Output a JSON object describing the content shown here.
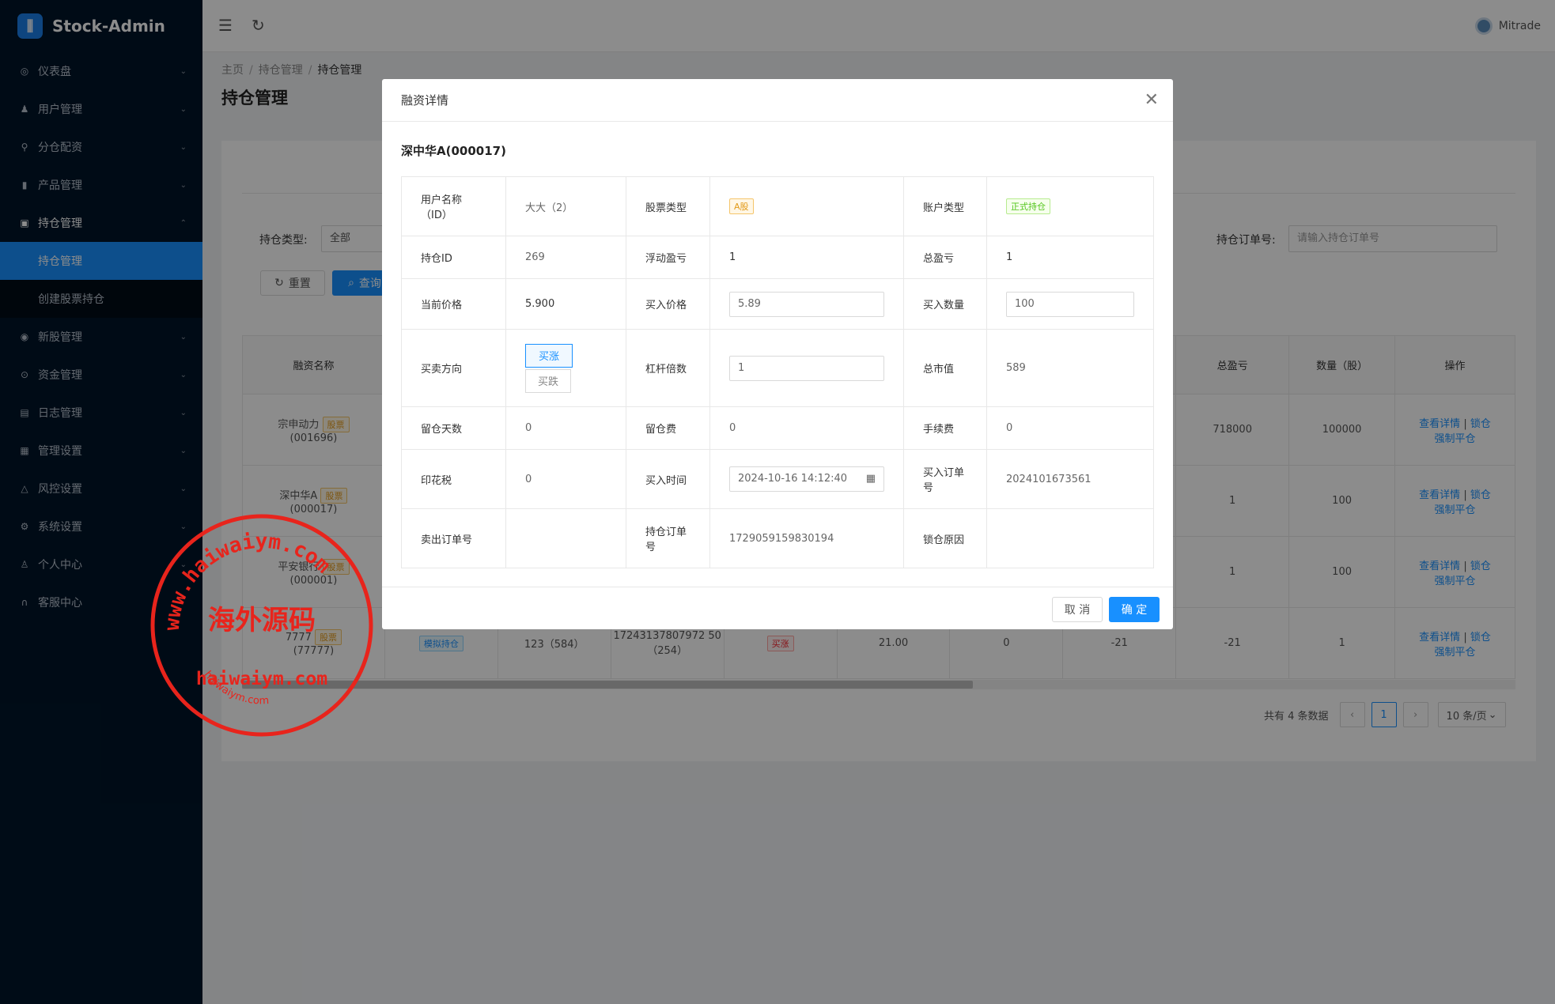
{
  "app": {
    "name": "Stock-Admin",
    "user": "Mitrade"
  },
  "sidebar": {
    "items": [
      {
        "label": "仪表盘",
        "icon": "dashboard-icon"
      },
      {
        "label": "用户管理",
        "icon": "users-icon"
      },
      {
        "label": "分仓配资",
        "icon": "tree-icon"
      },
      {
        "label": "产品管理",
        "icon": "chart-icon"
      },
      {
        "label": "持仓管理",
        "icon": "position-icon"
      }
    ],
    "sub": [
      "持仓管理",
      "创建股票持仓"
    ],
    "items2": [
      {
        "label": "新股管理",
        "icon": "ipo-icon"
      },
      {
        "label": "资金管理",
        "icon": "money-icon"
      },
      {
        "label": "日志管理",
        "icon": "log-icon"
      },
      {
        "label": "管理设置",
        "icon": "admin-icon"
      },
      {
        "label": "风控设置",
        "icon": "warning-icon"
      },
      {
        "label": "系统设置",
        "icon": "settings-icon"
      },
      {
        "label": "个人中心",
        "icon": "person-icon"
      },
      {
        "label": "客服中心",
        "icon": "headset-icon"
      }
    ]
  },
  "breadcrumb": [
    "主页",
    "持仓管理",
    "持仓管理"
  ],
  "page_title": "持仓管理",
  "filters": {
    "type_label": "持仓类型:",
    "type_value": "全部",
    "order_label": "持仓订单号:",
    "order_placeholder": "请输入持仓订单号",
    "reset": "重置",
    "query": "查询"
  },
  "table": {
    "headers": [
      "融资名称",
      "总盈亏",
      "数量（股）",
      "操作"
    ],
    "rows": [
      {
        "name": "宗申动力",
        "tag": "股票",
        "code": "(001696)",
        "pnl": "718000",
        "qty": "100000"
      },
      {
        "name": "深中华A",
        "tag": "股票",
        "code": "(000017)",
        "pnl": "1",
        "qty": "100"
      },
      {
        "name": "平安银行",
        "tag": "股票",
        "code": "(000001)",
        "pnl": "1",
        "qty": "100"
      },
      {
        "name": "7777",
        "tag": "股票",
        "code": "(77777)",
        "acct": "模拟持仓",
        "user": "123（584）",
        "order": "17243137807972 50（254）",
        "dir": "买涨",
        "price": "21.00",
        "f1": "0",
        "f2": "-21",
        "pnl": "-21",
        "qty": "1"
      }
    ],
    "actions": {
      "detail": "查看详情",
      "lock": "锁仓",
      "force": "强制平仓"
    }
  },
  "pagination": {
    "total": "共有 4 条数据",
    "page": "1",
    "size": "10 条/页"
  },
  "modal": {
    "title": "融资详情",
    "stock": "深中华A(000017)",
    "labels": {
      "user": "用户名称（ID）",
      "stock_type": "股票类型",
      "acct_type": "账户类型",
      "pos_id": "持仓ID",
      "float_pnl": "浮动盈亏",
      "total_pnl": "总盈亏",
      "cur_price": "当前价格",
      "buy_price": "买入价格",
      "buy_qty": "买入数量",
      "direction": "买卖方向",
      "leverage": "杠杆倍数",
      "market_value": "总市值",
      "hold_days": "留仓天数",
      "hold_fee": "留仓费",
      "fee": "手续费",
      "stamp": "印花税",
      "buy_time": "买入时间",
      "buy_order": "买入订单号",
      "sell_order": "卖出订单号",
      "pos_order": "持仓订单号",
      "lock_reason": "锁仓原因"
    },
    "values": {
      "user": "大大（2）",
      "stock_type": "A股",
      "acct_type": "正式持仓",
      "pos_id": "269",
      "float_pnl": "1",
      "total_pnl": "1",
      "cur_price": "5.900",
      "buy_price": "5.89",
      "buy_qty": "100",
      "dir_up": "买涨",
      "dir_down": "买跌",
      "leverage": "1",
      "market_value": "589",
      "hold_days": "0",
      "hold_fee": "0",
      "fee": "0",
      "stamp": "0",
      "buy_time": "2024-10-16 14:12:40",
      "buy_order": "2024101673561",
      "sell_order": "",
      "pos_order": "1729059159830194",
      "lock_reason": ""
    },
    "cancel": "取 消",
    "ok": "确 定"
  },
  "watermark": {
    "url": "www.haiwaiym.com",
    "cn": "海外源码",
    "en": "haiwaiym.com",
    "small": "haiwaiym.com"
  }
}
